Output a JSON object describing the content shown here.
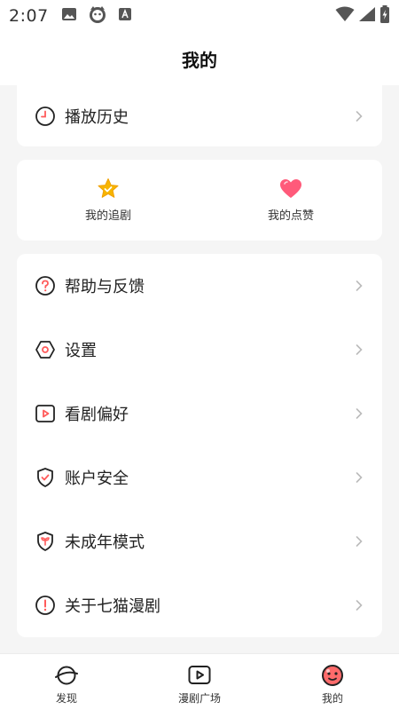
{
  "status_bar": {
    "time": "2:07",
    "left_icons": [
      "image-icon",
      "cat-mascot-icon",
      "font-a-icon"
    ],
    "right_icons": [
      "wifi-icon",
      "signal-icon",
      "battery-charging-icon"
    ]
  },
  "header": {
    "title": "我的"
  },
  "history": {
    "label": "播放历史",
    "icon": "clock-icon"
  },
  "favorites": [
    {
      "label": "我的追剧",
      "icon": "star-icon",
      "color": "#f7b500"
    },
    {
      "label": "我的点赞",
      "icon": "heart-icon",
      "color": "#ff5a7a"
    }
  ],
  "menu": [
    {
      "label": "帮助与反馈",
      "icon": "question-icon"
    },
    {
      "label": "设置",
      "icon": "settings-hexagon-icon"
    },
    {
      "label": "看剧偏好",
      "icon": "play-square-icon"
    },
    {
      "label": "账户安全",
      "icon": "shield-check-icon"
    },
    {
      "label": "未成年模式",
      "icon": "shield-sprout-icon"
    },
    {
      "label": "关于七猫漫剧",
      "icon": "info-icon"
    }
  ],
  "tabs": [
    {
      "label": "发现",
      "icon": "planet-icon"
    },
    {
      "label": "漫剧广场",
      "icon": "play-tv-icon"
    },
    {
      "label": "我的",
      "icon": "face-icon",
      "active": true
    }
  ],
  "colors": {
    "accent": "#ff5a5a",
    "background": "#f5f5f5"
  }
}
